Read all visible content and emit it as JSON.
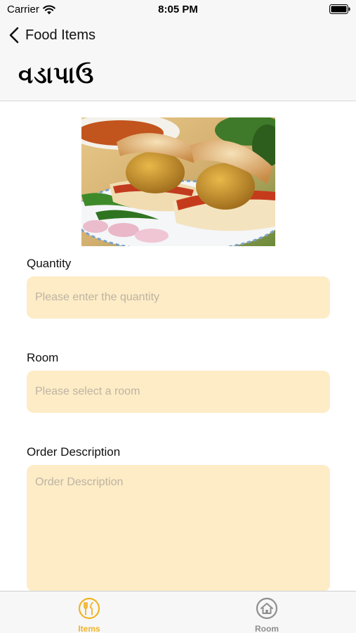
{
  "status_bar": {
    "carrier": "Carrier",
    "time": "8:05 PM"
  },
  "nav": {
    "back_label": "Food Items",
    "title": "વડાપાઉ"
  },
  "food_image": {
    "description_icon": "vada-pav-photo"
  },
  "form": {
    "quantity": {
      "label": "Quantity",
      "placeholder": "Please enter the quantity",
      "value": ""
    },
    "room": {
      "label": "Room",
      "placeholder": "Please select a room",
      "value": ""
    },
    "order_description": {
      "label": "Order Description",
      "placeholder": "Order Description",
      "value": ""
    }
  },
  "tab_bar": {
    "tabs": [
      {
        "label": "Items",
        "icon": "fork-knife-icon",
        "active": true
      },
      {
        "label": "Room",
        "icon": "home-icon",
        "active": false
      }
    ]
  },
  "colors": {
    "accent": "#f0b429",
    "field_background": "#fdecc6",
    "inactive_tab": "#8e8e8e"
  }
}
